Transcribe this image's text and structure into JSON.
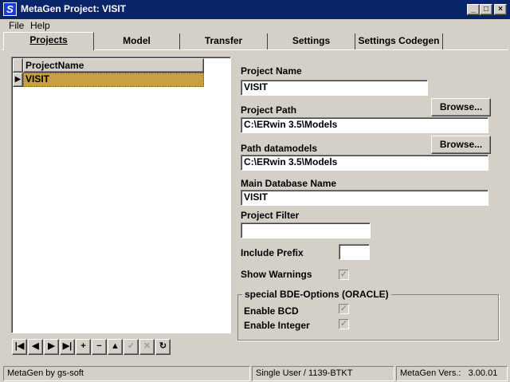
{
  "window": {
    "title": "MetaGen  Project: VISIT",
    "icon_letter": "S",
    "minimize_glyph": "_",
    "maximize_glyph": "□",
    "close_glyph": "×"
  },
  "menu": {
    "file": "File",
    "help": "Help"
  },
  "tabs": [
    {
      "label": "Projects",
      "active": true
    },
    {
      "label": "Model"
    },
    {
      "label": "Transfer"
    },
    {
      "label": "Settings"
    },
    {
      "label": "Settings Codegen"
    }
  ],
  "grid": {
    "column_header": "ProjectName",
    "rows": [
      {
        "indicator": "▶",
        "project_name": "VISIT"
      }
    ]
  },
  "navigator": [
    {
      "name": "first-record-button",
      "glyph": "|◀",
      "enabled": true
    },
    {
      "name": "prior-record-button",
      "glyph": "◀",
      "enabled": true
    },
    {
      "name": "next-record-button",
      "glyph": "▶",
      "enabled": true
    },
    {
      "name": "last-record-button",
      "glyph": "▶|",
      "enabled": true
    },
    {
      "name": "insert-record-button",
      "glyph": "+",
      "enabled": true
    },
    {
      "name": "delete-record-button",
      "glyph": "−",
      "enabled": true
    },
    {
      "name": "edit-record-button",
      "glyph": "▲",
      "enabled": true
    },
    {
      "name": "post-record-button",
      "glyph": "✓",
      "enabled": false
    },
    {
      "name": "cancel-record-button",
      "glyph": "✕",
      "enabled": false
    },
    {
      "name": "refresh-records-button",
      "glyph": "↻",
      "enabled": true
    }
  ],
  "form": {
    "project_name_label": "Project Name",
    "project_name_value": "VISIT",
    "project_path_label": "Project Path",
    "project_path_value": "C:\\ERwin 3.5\\Models",
    "browse_label": "Browse...",
    "path_datamodels_label": "Path datamodels",
    "path_datamodels_value": "C:\\ERwin 3.5\\Models",
    "main_db_label": "Main Database Name",
    "main_db_value": "VISIT",
    "project_filter_label": "Project Filter",
    "project_filter_value": "",
    "include_prefix_label": "Include Prefix",
    "include_prefix_value": "",
    "show_warnings_label": "Show Warnings",
    "show_warnings_checked": true,
    "bde_group_title": "special BDE-Options (ORACLE)",
    "enable_bcd_label": "Enable BCD",
    "enable_bcd_checked": true,
    "enable_integer_label": "Enable Integer",
    "enable_integer_checked": true,
    "check_glyph": "✓"
  },
  "status": {
    "left": "MetaGen by gs-soft",
    "middle": "Single User / 1139-BTKT",
    "version_label": "MetaGen Vers.:",
    "version_value": "3.00.01"
  }
}
